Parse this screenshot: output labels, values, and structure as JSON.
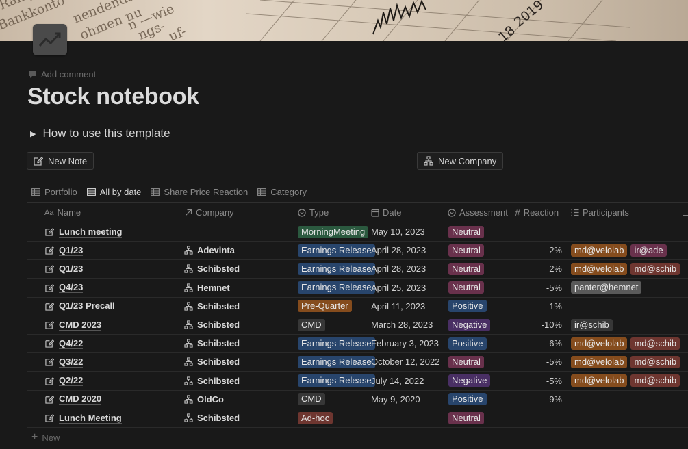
{
  "page": {
    "title": "Stock notebook",
    "add_comment": "Add comment",
    "toggle_label": "How to use this template",
    "new_note_label": "New Note",
    "new_company_label": "New Company",
    "new_row_label": "New",
    "cover_text": {
      "year": "2019",
      "year_partial": "18",
      "words": [
        "Rampe",
        "Bankkonto",
        "nendenda",
        "ohmen nu",
        "n —wie",
        "ngs-",
        "uf-"
      ]
    }
  },
  "tabs": [
    {
      "label": "Portfolio",
      "icon": "table-icon",
      "active": false
    },
    {
      "label": "All by date",
      "icon": "table-icon",
      "active": true
    },
    {
      "label": "Share Price Reaction",
      "icon": "table-icon",
      "active": false
    },
    {
      "label": "Category",
      "icon": "table-icon",
      "active": false
    }
  ],
  "columns": {
    "name": "Name",
    "company": "Company",
    "type": "Type",
    "date": "Date",
    "assessment": "Assessment",
    "reaction": "Reaction",
    "participants": "Participants"
  },
  "rows": [
    {
      "name": "Lunch meeting",
      "company": "",
      "type": "MorningMeeting",
      "date": "May 10, 2023",
      "assessment": "Neutral",
      "reaction": "",
      "participants": []
    },
    {
      "name": "Q1/23",
      "company": "Adevinta",
      "type": "Earnings Release",
      "date": "April 28, 2023",
      "assessment": "Neutral",
      "reaction": "2%",
      "participants": [
        "md@velolab",
        "ir@ade"
      ]
    },
    {
      "name": "Q1/23",
      "company": "Schibsted",
      "type": "Earnings Release",
      "date": "April 28, 2023",
      "assessment": "Neutral",
      "reaction": "2%",
      "participants": [
        "md@velolab",
        "md@schib"
      ]
    },
    {
      "name": "Q4/23",
      "company": "Hemnet",
      "type": "Earnings Release",
      "date": "April 25, 2023",
      "assessment": "Neutral",
      "reaction": "-5%",
      "participants": [
        "panter@hemnet"
      ]
    },
    {
      "name": "Q1/23 Precall",
      "company": "Schibsted",
      "type": "Pre-Quarter",
      "date": "April 11, 2023",
      "assessment": "Positive",
      "reaction": "1%",
      "participants": []
    },
    {
      "name": "CMD 2023",
      "company": "Schibsted",
      "type": "CMD",
      "date": "March 28, 2023",
      "assessment": "Negative",
      "reaction": "-10%",
      "participants": [
        "ir@schib"
      ]
    },
    {
      "name": "Q4/22",
      "company": "Schibsted",
      "type": "Earnings Release",
      "date": "February 3, 2023",
      "assessment": "Positive",
      "reaction": "6%",
      "participants": [
        "md@velolab",
        "md@schib"
      ]
    },
    {
      "name": "Q3/22",
      "company": "Schibsted",
      "type": "Earnings Release",
      "date": "October 12, 2022",
      "assessment": "Neutral",
      "reaction": "-5%",
      "participants": [
        "md@velolab",
        "md@schib"
      ]
    },
    {
      "name": "Q2/22",
      "company": "Schibsted",
      "type": "Earnings Release",
      "date": "July 14, 2022",
      "assessment": "Negative",
      "reaction": "-5%",
      "participants": [
        "md@velolab",
        "md@schib"
      ]
    },
    {
      "name": "CMD 2020",
      "company": "OldCo",
      "type": "CMD",
      "date": "May 9, 2020",
      "assessment": "Positive",
      "reaction": "9%",
      "participants": []
    },
    {
      "name": "Lunch Meeting",
      "company": "Schibsted",
      "type": "Ad-hoc",
      "date": "",
      "assessment": "Neutral",
      "reaction": "",
      "participants": []
    }
  ],
  "colors": {
    "type": {
      "MorningMeeting": "#2b593f",
      "Earnings Release": "#28456c",
      "Pre-Quarter": "#854c1d",
      "CMD": "#373737",
      "Ad-hoc": "#6e3630"
    },
    "assessment": {
      "Neutral": "#69314c",
      "Positive": "#28456c",
      "Negative": "#492f64"
    },
    "participants": {
      "md@velolab": "#854c1d",
      "ir@ade": "#69314c",
      "md@schib": "#6e3630",
      "panter@hemnet": "#5a5a5a",
      "ir@schib": "#373737"
    }
  }
}
